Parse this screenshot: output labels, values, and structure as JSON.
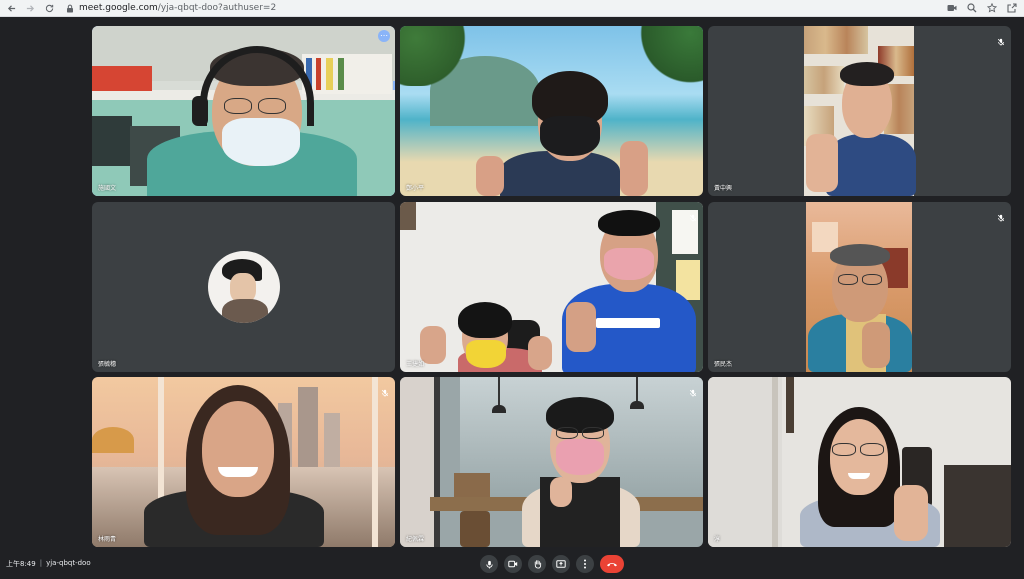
{
  "browser": {
    "url_host": "meet.google.com",
    "url_path": "/yja-qbqt-doo?authuser=2"
  },
  "tiles": [
    {
      "name": "施國文"
    },
    {
      "name": "鄭小平"
    },
    {
      "name": "黃中興"
    },
    {
      "name": "張毓穗"
    },
    {
      "name": "王捷如"
    },
    {
      "name": "張民杰"
    },
    {
      "name": "林雨青"
    },
    {
      "name": "紀佩霖"
    },
    {
      "name": "淳"
    }
  ],
  "meeting": {
    "time": "上午8:49",
    "separator": "|",
    "code": "yja-qbqt-doo"
  },
  "icons": {
    "back": "arrow-left-icon",
    "forward": "arrow-right-icon",
    "reload": "reload-icon",
    "lock": "lock-icon",
    "mic_muted": "mic-off-icon",
    "more": "more-options-icon",
    "mic": "mic-icon",
    "camera": "camera-icon",
    "raise_hand": "raise-hand-icon",
    "present": "present-screen-icon",
    "more_vert": "more-vert-icon",
    "end_call": "end-call-icon"
  },
  "colors": {
    "background": "#202124",
    "tile": "#3c4043",
    "active_outline": "#8ab4f8",
    "end_call": "#ea4335"
  }
}
